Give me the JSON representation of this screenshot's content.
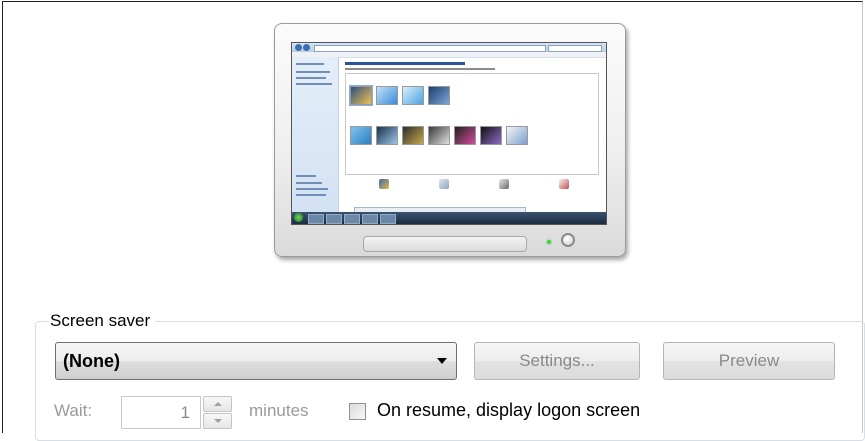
{
  "screen_saver": {
    "group_label": "Screen saver",
    "selected": "(None)",
    "settings_label": "Settings...",
    "preview_label": "Preview",
    "wait_label": "Wait:",
    "wait_value": "1",
    "minutes_label": "minutes",
    "logon_checkbox_label": "On resume, display logon screen",
    "logon_checked": false
  },
  "colors": {
    "group_border": "#d5dfe5",
    "disabled_text": "#8a8a8a",
    "power_led": "#3fd13f"
  }
}
